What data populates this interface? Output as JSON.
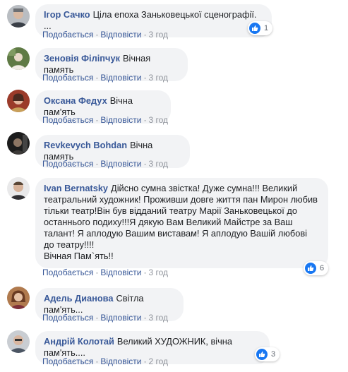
{
  "like_color": "#1877f2",
  "comments": [
    {
      "name": "Ігор Сачко",
      "text": "Ціла епоха Заньковецької сценографії. ...",
      "like": "Подобається",
      "reply": "Відповісти",
      "time": "3 год",
      "reactions": "1"
    },
    {
      "name": "Зеновія Філіпчук",
      "text": "Вічная память",
      "like": "Подобається",
      "reply": "Відповісти",
      "time": "3 год"
    },
    {
      "name": "Оксана Федух",
      "text": "Вічна пам'ять",
      "like": "Подобається",
      "reply": "Відповісти",
      "time": "3 год"
    },
    {
      "name": "Revkevych Bohdan",
      "text": "Вічна память",
      "like": "Подобається",
      "reply": "Відповісти",
      "time": "3 год"
    },
    {
      "name": "Ivan Bernatsky",
      "text": "Дійсно сумна звістка! Дуже сумна!!! Великий театральний художник! Проживши довге життя пан Мирон любив тільки театр!Він був відданий театру Марії Заньковецької до останнього подиху!!!Я дякую Вам Великий Майстре за Ваш талант! Я аплодую Вашим виставам! Я аплодую Вашій любові до театру!!!!",
      "text2": "Вічная Пам`ять!!",
      "like": "Подобається",
      "reply": "Відповісти",
      "time": "3 год",
      "reactions": "6"
    },
    {
      "name": "Адель Дианова",
      "text": "Світла пам'ять...",
      "like": "Подобається",
      "reply": "Відповісти",
      "time": "3 год"
    },
    {
      "name": "Андрій Колотай",
      "text": "Великий ХУДОЖНИК, вічна пам'ять....",
      "like": "Подобається",
      "reply": "Відповісти",
      "time": "2 год",
      "reactions": "3"
    }
  ]
}
